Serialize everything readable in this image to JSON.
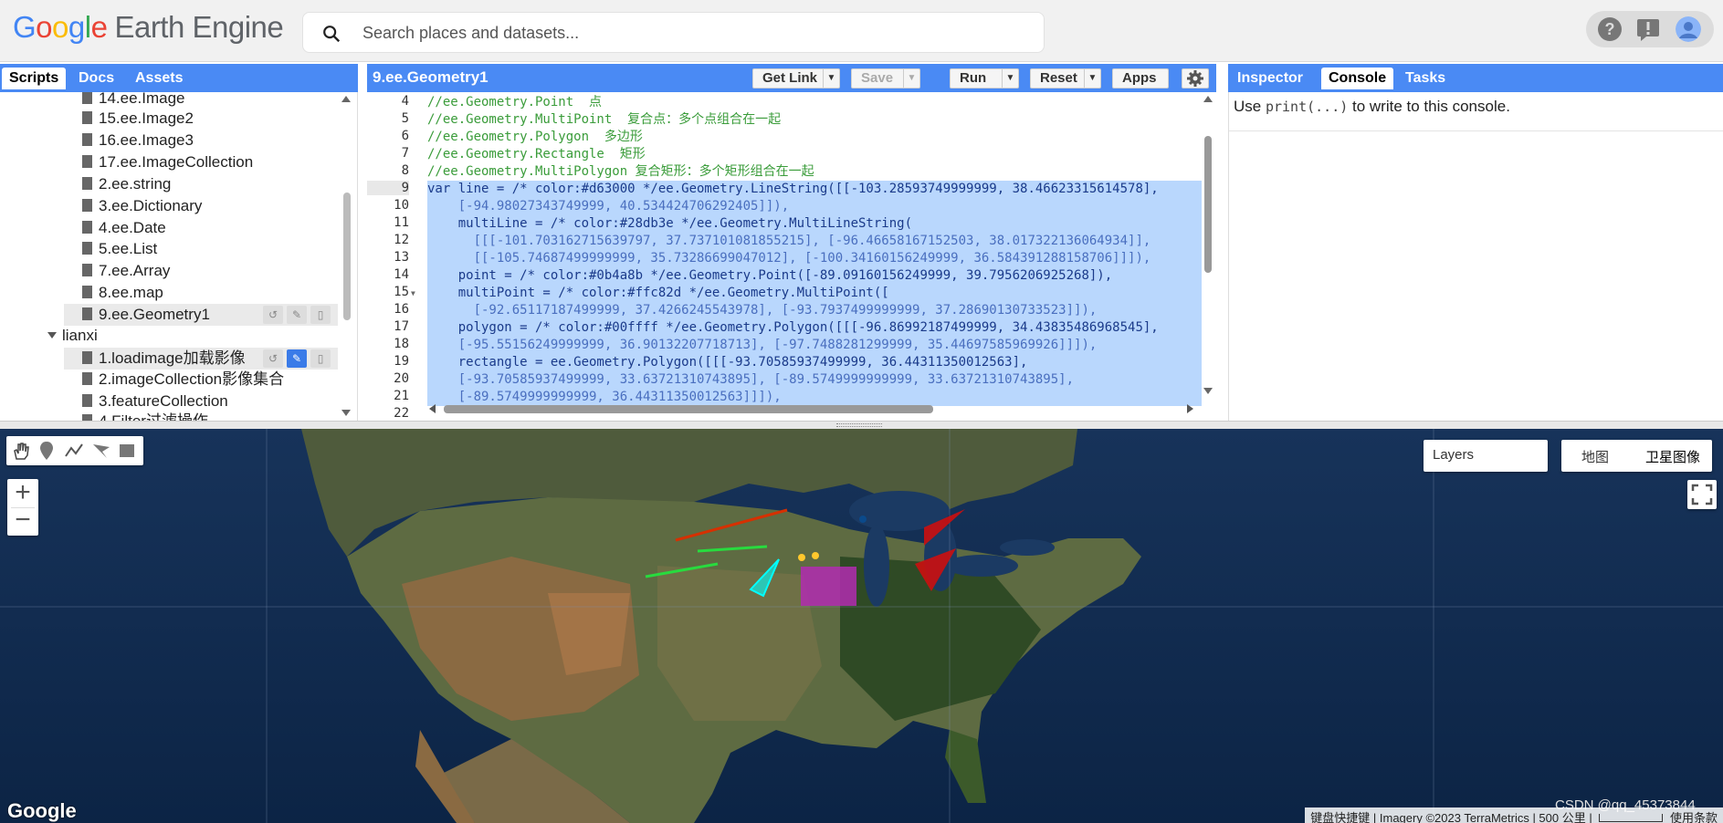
{
  "topbar": {
    "logo_letters": [
      "G",
      "o",
      "o",
      "g",
      "l",
      "e"
    ],
    "product": "Earth Engine",
    "search_placeholder": "Search places and datasets..."
  },
  "left_panel": {
    "tabs": [
      {
        "label": "Scripts",
        "active": true
      },
      {
        "label": "Docs",
        "active": false
      },
      {
        "label": "Assets",
        "active": false
      }
    ],
    "items": [
      "14.ee.Image",
      "15.ee.Image2",
      "16.ee.Image3",
      "17.ee.ImageCollection",
      "2.ee.string",
      "3.ee.Dictionary",
      "4.ee.Date",
      "5.ee.List",
      "7.ee.Array",
      "8.ee.map",
      "9.ee.Geometry1"
    ],
    "folder": "lianxi",
    "folder_items": [
      "1.loadimage加载影像",
      "2.imageCollection影像集合",
      "3.featureCollection",
      "4.Filter过滤操作"
    ]
  },
  "editor": {
    "title": "9.ee.Geometry1",
    "buttons": {
      "get_link": "Get Link",
      "save": "Save",
      "run": "Run",
      "reset": "Reset",
      "apps": "Apps"
    },
    "line_numbers": [
      "4",
      "5",
      "6",
      "7",
      "8",
      "9",
      "10",
      "11",
      "12",
      "13",
      "14",
      "15",
      "16",
      "17",
      "18",
      "19",
      "20",
      "21",
      "22"
    ],
    "lines": [
      "//ee.Geometry.Point  点",
      "//ee.Geometry.MultiPoint  复合点：多个点组合在一起",
      "//ee.Geometry.Polygon  多边形",
      "//ee.Geometry.Rectangle  矩形",
      "//ee.Geometry.MultiPolygon 复合矩形：多个矩形组合在一起",
      "var line = /* color:#d63000 */ee.Geometry.LineString([[-103.28593749999999, 38.46623315614578],",
      "    [-94.98027343749999, 40.534424706292405]]),",
      "    multiLine = /* color:#28db3e */ee.Geometry.MultiLineString(",
      "      [[[-101.703162715639797, 37.737101081855215], [-96.46658167152503, 38.017322136064934]],",
      "      [[-105.74687499999999, 35.73286699047012], [-100.34160156249999, 36.584391288158706]]]),",
      "    point = /* color:#0b4a8b */ee.Geometry.Point([-89.09160156249999, 39.7956206925268]),",
      "    multiPoint = /* color:#ffc82d */ee.Geometry.MultiPoint([",
      "      [-92.65117187499999, 37.4266245543978], [-93.7937499999999, 37.28690130733523]]),",
      "    polygon = /* color:#00ffff */ee.Geometry.Polygon([[[-96.86992187499999, 34.43835486968545],",
      "    [-95.55156249999999, 36.90132207718713], [-97.7488281299999, 35.44697585969926]]]),",
      "    rectangle = ee.Geometry.Polygon([[[-93.70585937499999, 36.44311350012563],",
      "    [-93.70585937499999, 33.63721310743895], [-89.5749999999999, 33.63721310743895],",
      "    [-89.5749999999999, 36.44311350012563]]]),",
      ""
    ]
  },
  "right_panel": {
    "tabs": [
      {
        "label": "Inspector",
        "active": false
      },
      {
        "label": "Console",
        "active": true
      },
      {
        "label": "Tasks",
        "active": false
      }
    ],
    "console_pre": "Use ",
    "console_code": "print(...)",
    "console_post": " to write to this console."
  },
  "map": {
    "layers_label": "Layers",
    "map_type_map": "地图",
    "map_type_satellite": "卫星图像",
    "google_mark": "Google",
    "footer": "键盘快捷键 | Imagery ©2023 TerraMetrics | 500 公里 |",
    "footer_end": "使用条款",
    "watermark": "CSDN @qq_45373844",
    "colors": {
      "line": "#d63000",
      "multiLine": "#28db3e",
      "point": "#0b4a8b",
      "multiPoint": "#ffc82d",
      "polygon": "#00ffff",
      "rectangle": "#b22bb0",
      "red_polygons": "#cc1010"
    }
  }
}
